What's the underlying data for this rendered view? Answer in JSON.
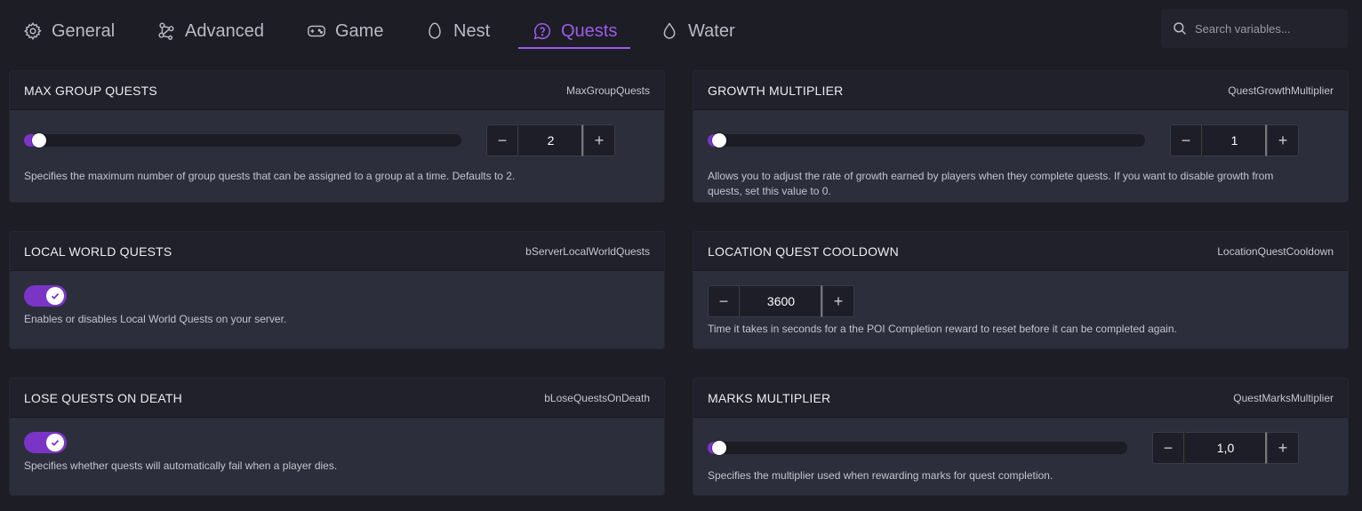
{
  "tabs": [
    {
      "label": "General",
      "icon": "gear-icon",
      "active": false
    },
    {
      "label": "Advanced",
      "icon": "nodes-icon",
      "active": false
    },
    {
      "label": "Game",
      "icon": "gamepad-icon",
      "active": false
    },
    {
      "label": "Nest",
      "icon": "egg-icon",
      "active": false
    },
    {
      "label": "Quests",
      "icon": "question-bubble-icon",
      "active": true
    },
    {
      "label": "Water",
      "icon": "droplet-icon",
      "active": false
    }
  ],
  "search": {
    "placeholder": "Search variables..."
  },
  "colors": {
    "accent": "#9d5ce8",
    "toggle_on": "#7a35c6",
    "card_bg": "#2c2e3b",
    "header_bg": "#20212a",
    "page_bg": "#1c1d25"
  },
  "cards": {
    "max_group_quests": {
      "title": "MAX GROUP QUESTS",
      "variable": "MaxGroupQuests",
      "value": "2",
      "slider_fraction": 0.0,
      "description": "Specifies the maximum number of group quests that can be assigned to a group at a time. Defaults to 2."
    },
    "growth_multiplier": {
      "title": "GROWTH MULTIPLIER",
      "variable": "QuestGrowthMultiplier",
      "value": "1",
      "slider_fraction": 0.0,
      "description_line1": "Allows you to adjust the rate of growth earned by players when they complete quests. If you want to disable growth from",
      "description_line2": "quests, set this value to 0."
    },
    "local_world_quests": {
      "title": "LOCAL WORLD QUESTS",
      "variable": "bServerLocalWorldQuests",
      "enabled": true,
      "description": "Enables or disables Local World Quests on your server."
    },
    "location_quest_cooldown": {
      "title": "LOCATION QUEST COOLDOWN",
      "variable": "LocationQuestCooldown",
      "value": "3600",
      "description": "Time it takes in seconds for a the POI Completion reward to reset before it can be completed again."
    },
    "lose_quests_on_death": {
      "title": "LOSE QUESTS ON DEATH",
      "variable": "bLoseQuestsOnDeath",
      "enabled": true,
      "description": "Specifies whether quests will automatically fail when a player dies."
    },
    "marks_multiplier": {
      "title": "MARKS MULTIPLIER",
      "variable": "QuestMarksMultiplier",
      "value": "1,0",
      "slider_fraction": 0.0,
      "description": "Specifies the multiplier used when rewarding marks for quest completion."
    }
  },
  "stepper": {
    "minus": "−",
    "plus": "+"
  }
}
